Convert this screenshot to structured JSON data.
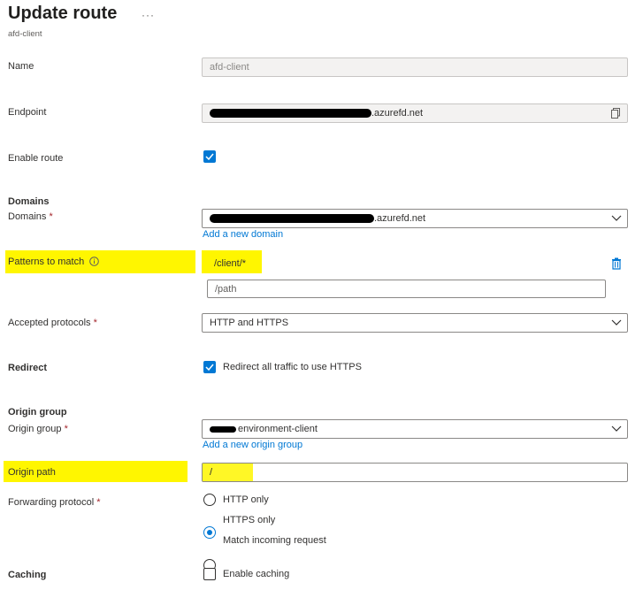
{
  "header": {
    "title": "Update route",
    "ellipsis": "···",
    "subtitle": "afd-client"
  },
  "form": {
    "name": {
      "label": "Name",
      "value": "afd-client"
    },
    "endpoint": {
      "label": "Endpoint",
      "value_suffix": ".azurefd.net",
      "copy_icon": "copy-icon"
    },
    "enable_route": {
      "label": "Enable route",
      "checked": true
    },
    "domains": {
      "section": "Domains",
      "label": "Domains",
      "required_mark": "*",
      "value_suffix": ".azurefd.net",
      "add_link": "Add a new domain"
    },
    "patterns": {
      "label": "Patterns to match",
      "info_icon": "info-icon",
      "existing": "/client/*",
      "placeholder": "/path",
      "delete_icon": "trash-icon"
    },
    "protocols": {
      "label": "Accepted protocols",
      "required_mark": "*",
      "value": "HTTP and HTTPS"
    },
    "redirect": {
      "label": "Redirect",
      "checkbox_label": "Redirect all traffic to use HTTPS",
      "checked": true
    },
    "origin_group": {
      "section": "Origin group",
      "label": "Origin group",
      "required_mark": "*",
      "value": "environment-client",
      "add_link": "Add a new origin group"
    },
    "origin_path": {
      "label": "Origin path",
      "value": "/"
    },
    "forwarding": {
      "label": "Forwarding protocol",
      "required_mark": "*",
      "options": [
        "HTTP only",
        "HTTPS only",
        "Match incoming request"
      ],
      "selected": "HTTPS only"
    },
    "caching": {
      "label": "Caching",
      "checkbox_label": "Enable caching",
      "checked": false
    }
  },
  "colors": {
    "accent": "#0078d4",
    "highlight": "#fff600",
    "required": "#a4262c",
    "redaction": "#000000"
  }
}
